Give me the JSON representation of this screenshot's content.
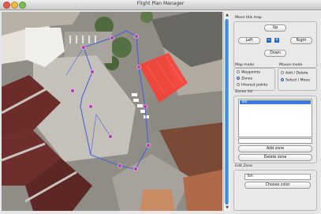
{
  "window": {
    "title": "Flight Plan Manager"
  },
  "move_map": {
    "label": "Move this map",
    "up": "Up",
    "left": "Left",
    "right": "Right",
    "down": "Down",
    "zoom_out": "−",
    "zoom_in": "+"
  },
  "map_mode": {
    "label": "Map mode",
    "options": [
      "Waypoints",
      "Zones",
      "Interest points"
    ],
    "selected": "Zones"
  },
  "mouse_mode": {
    "label": "Mouse mode",
    "options": [
      "Add / Delete",
      "Select / Move"
    ],
    "selected": "Select / Move"
  },
  "zones_list": {
    "label": "Zones list",
    "items": [
      "Toh"
    ],
    "selected": "Toh",
    "new_zone_value": "",
    "add_button": "Add zone",
    "delete_button": "Delete zone"
  },
  "edit_zone": {
    "label": "Edit Zone",
    "name_value": "Toh",
    "color_button": "Choose color",
    "zone_color": "#ff3b30"
  },
  "colors": {
    "path": "#4a5fdc",
    "waypoint_fill": "#b13fb4",
    "selection_blue": "#3b7be0"
  }
}
